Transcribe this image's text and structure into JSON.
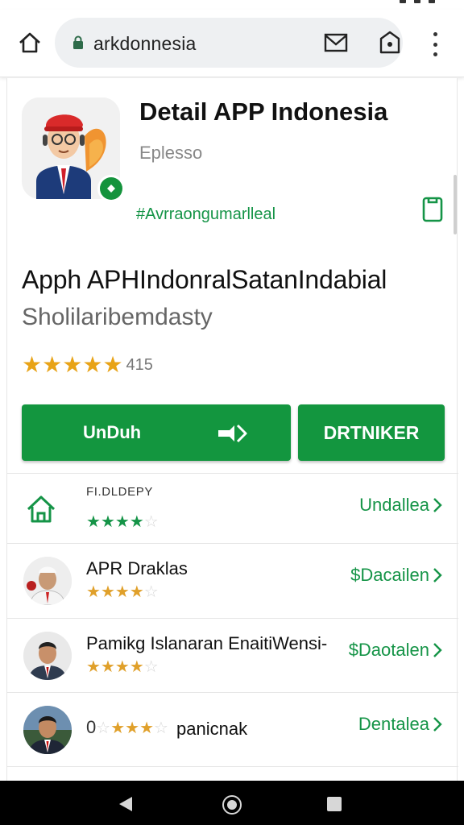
{
  "browser": {
    "url": "arkdonnesia",
    "icons": [
      "home-icon",
      "lock-icon",
      "mail-icon",
      "shield-icon",
      "more-vert-icon"
    ]
  },
  "app": {
    "title": "Detail APP Indonesia",
    "developer": "Eplesso",
    "tag": "#Avrraongumarlleal",
    "name": "Apph APHIndonralSatanIndabial",
    "subtitle": "Sholilaribemdasty",
    "rating_value": 5,
    "rating_count": "415",
    "accent_color": "#13963f",
    "star_color": "#e8a317"
  },
  "actions": {
    "download_label": "UnDuh",
    "secondary_label": "DRTNIKER"
  },
  "list": [
    {
      "title": "FI.DLDEPY",
      "rating": 3.5,
      "link": "Undallea",
      "icon": "home-outline-icon",
      "star_style": "green"
    },
    {
      "title": "APR Draklas",
      "rating": 4,
      "link": "$Dacailen",
      "icon": "avatar-person",
      "star_style": "gold"
    },
    {
      "title": "Pamikg Islanaran EnaitiWensi-",
      "rating": 3.5,
      "link": "$Daotalen",
      "icon": "avatar-person",
      "star_style": "gold"
    },
    {
      "title": "panicnak",
      "prefix": "0",
      "rating": 3,
      "link": "Dentalea",
      "icon": "avatar-person",
      "star_style": "gold"
    }
  ]
}
